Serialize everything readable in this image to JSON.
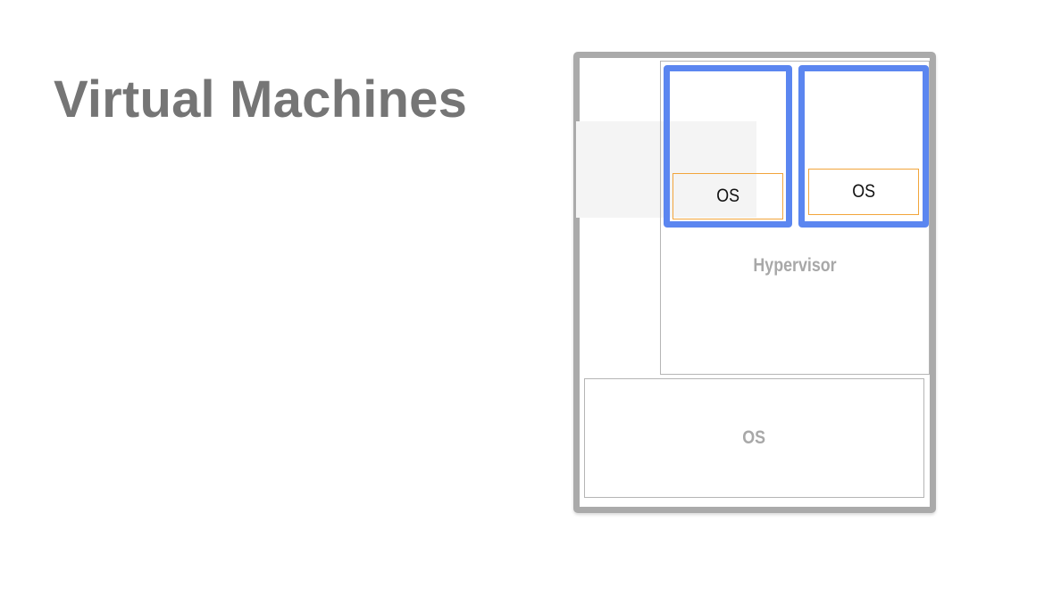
{
  "slide": {
    "title": "Virtual Machines"
  },
  "diagram": {
    "hypervisor_label": "Hypervisor",
    "host_os_label": "OS",
    "vms": [
      {
        "guest_os_label": "OS"
      },
      {
        "guest_os_label": "OS"
      }
    ]
  },
  "colors": {
    "title_text": "#757575",
    "machine_border": "#aaaaaa",
    "vm_border": "#5b86f0",
    "guest_os_border": "#f2a53c",
    "muted_label": "#a8a8a8"
  }
}
